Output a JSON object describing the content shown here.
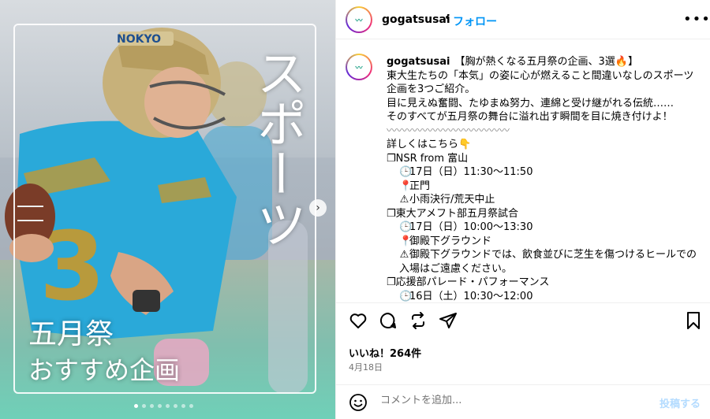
{
  "media": {
    "vertical_text": "スポーツ",
    "caption_line1": "五月祭",
    "caption_line2": "おすすめ企画",
    "jersey_number": "3",
    "slide_count": 8,
    "active_slide": 1
  },
  "header": {
    "username": "gogatsusai",
    "separator": "•",
    "follow_label": "フォロー",
    "more_label": "•••"
  },
  "caption": {
    "username": "gogatsusai",
    "lines": [
      "【胸が熱くなる五月祭の企画、3選🔥】",
      "東大生たちの「本気」の姿に心が燃えること間違いなしのスポーツ企画を3つご紹介。",
      "目に見えぬ奮闘、たゆまぬ努力、連綿と受け継がれる伝統……",
      "そのすべてが五月祭の舞台に溢れ出す瞬間を目に焼き付けよ！",
      "〰〰〰〰〰〰〰〰〰〰〰〰",
      "詳しくはこちら👇"
    ],
    "events": [
      {
        "title": "❐NSR from 富山",
        "time": "17日（日）11:30〜11:50",
        "place": "正門",
        "note": "小雨決行/荒天中止"
      },
      {
        "title": "❐東大アメフト部五月祭試合",
        "time": "17日（日）10:00〜13:30",
        "place": "御殿下グラウンド",
        "note": "御殿下グラウンドでは、飲食並びに芝生を傷つけるヒールでの入場はご遠慮ください。"
      },
      {
        "title": "❐応援部パレード・パフォーマンス",
        "time": "16日（土）10:30〜12:00"
      }
    ]
  },
  "stats": {
    "likes": "いいね！264件",
    "date": "4月18日"
  },
  "comment": {
    "placeholder": "コメントを追加...",
    "post_label": "投稿する"
  },
  "colors": {
    "follow": "#0095f6",
    "post_disabled": "#b3dbff",
    "jersey": "#2aa9d9"
  }
}
